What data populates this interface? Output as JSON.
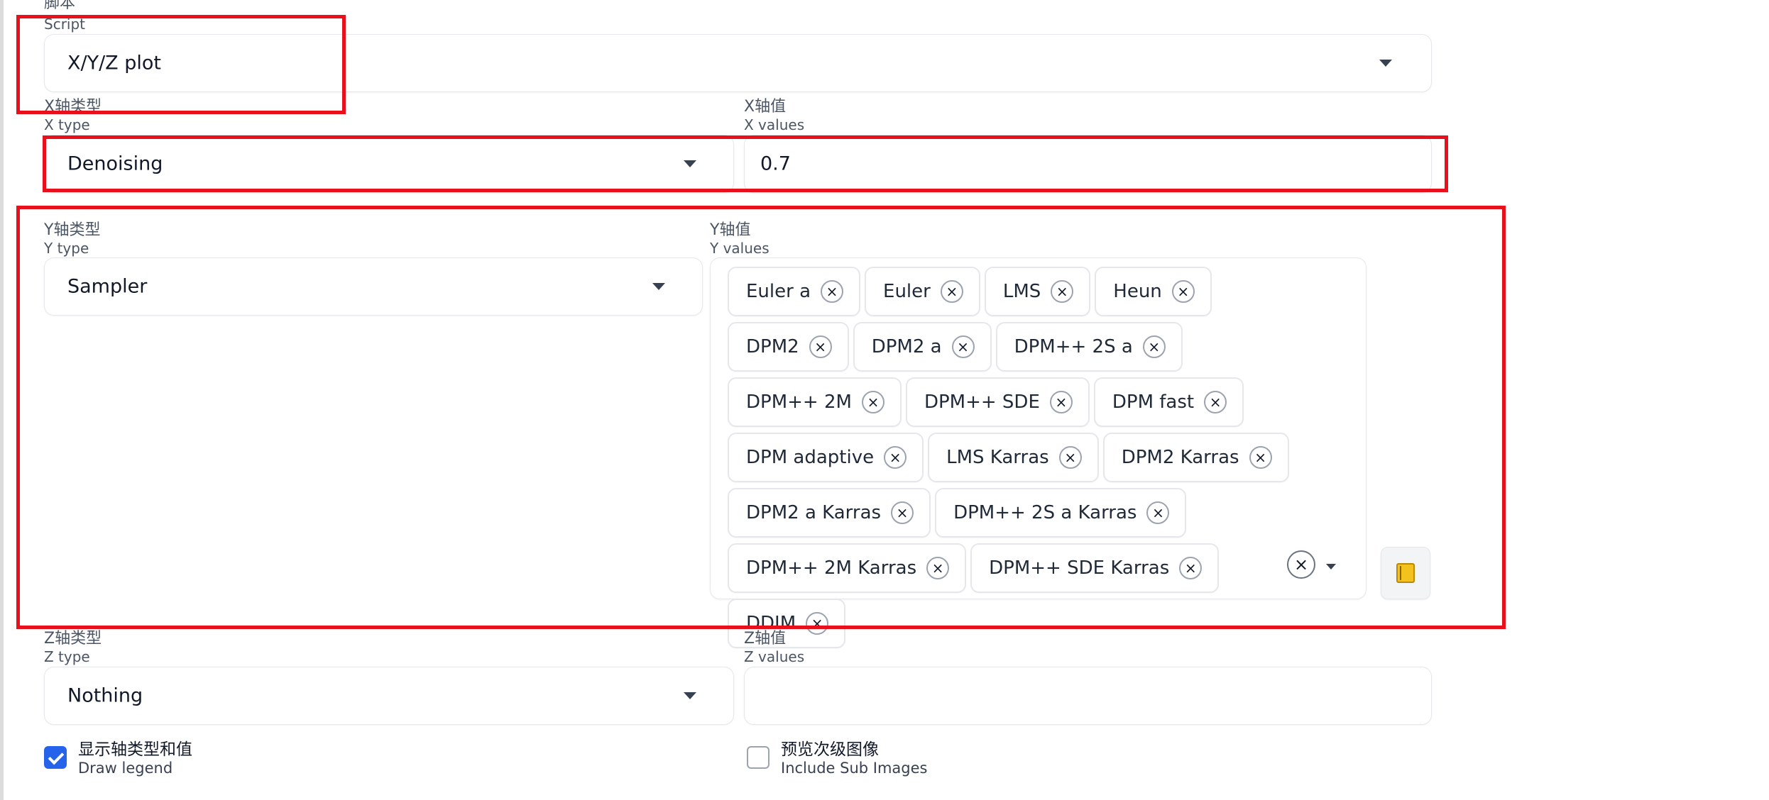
{
  "script": {
    "label_cn": "脚本",
    "label_en": "Script",
    "value": "X/Y/Z plot"
  },
  "x_type": {
    "label_cn": "X轴类型",
    "label_en": "X type",
    "value": "Denoising"
  },
  "x_values": {
    "label_cn": "X轴值",
    "label_en": "X values",
    "value": "0.7"
  },
  "y_type": {
    "label_cn": "Y轴类型",
    "label_en": "Y type",
    "value": "Sampler"
  },
  "y_values": {
    "label_cn": "Y轴值",
    "label_en": "Y values",
    "chips": [
      "Euler a",
      "Euler",
      "LMS",
      "Heun",
      "DPM2",
      "DPM2 a",
      "DPM++ 2S a",
      "DPM++ 2M",
      "DPM++ SDE",
      "DPM fast",
      "DPM adaptive",
      "LMS Karras",
      "DPM2 Karras",
      "DPM2 a Karras",
      "DPM++ 2S a Karras",
      "DPM++ 2M Karras",
      "DPM++ SDE Karras",
      "DDIM"
    ],
    "remove_glyph": "×",
    "clear_glyph": "×",
    "tool_icon": "notebook-icon"
  },
  "z_type": {
    "label_cn": "Z轴类型",
    "label_en": "Z type",
    "value": "Nothing"
  },
  "z_values": {
    "label_cn": "Z轴值",
    "label_en": "Z values",
    "value": ""
  },
  "draw_legend": {
    "label_cn": "显示轴类型和值",
    "label_en": "Draw legend",
    "checked": true
  },
  "include_sub_images": {
    "label_cn": "预览次级图像",
    "label_en": "Include Sub Images",
    "checked": false
  },
  "colors": {
    "highlight": "#e8101b",
    "checkbox_checked": "#2563eb"
  }
}
